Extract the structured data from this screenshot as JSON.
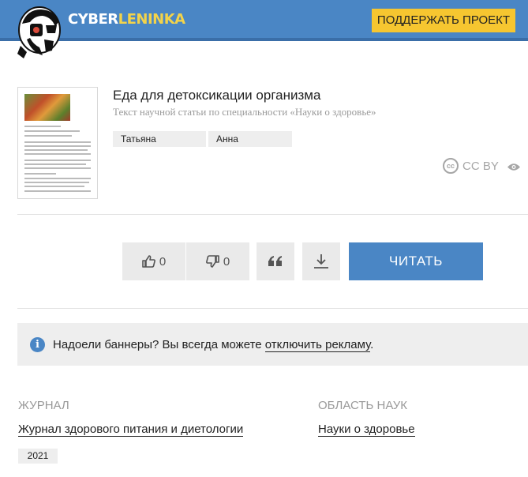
{
  "header": {
    "logo_part1": "CYBER",
    "logo_part2": "LENINKA",
    "support_button": "ПОДДЕРЖАТЬ ПРОЕКТ"
  },
  "article": {
    "title": "Еда для детоксикации организма",
    "subtitle": "Текст научной статьи по специальности «Науки о здоровье»",
    "authors": [
      "Татьяна",
      "Анна"
    ],
    "license": "CC BY"
  },
  "actions": {
    "likes": "0",
    "dislikes": "0",
    "read_label": "ЧИТАТЬ"
  },
  "notice": {
    "text_before": "Надоели баннеры? Вы всегда можете ",
    "link_text": "отключить рекламу",
    "text_after": "."
  },
  "meta": {
    "journal_label": "ЖУРНАЛ",
    "journal_name": "Журнал здорового питания и диетологии",
    "field_label": "ОБЛАСТЬ НАУК",
    "field_name": "Науки о здоровье",
    "year": "2021"
  },
  "colors": {
    "brand_blue": "#4a86c5",
    "support_yellow": "#f6c630"
  }
}
